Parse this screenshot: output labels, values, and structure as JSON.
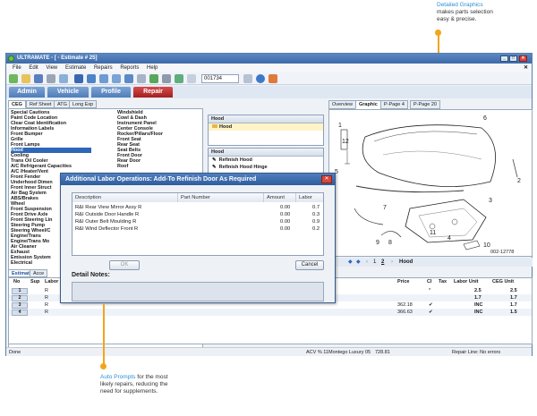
{
  "callouts": {
    "graphics": {
      "highlight": "Detailed Graphics",
      "rest": [
        "makes parts selection",
        "easy & precise."
      ]
    },
    "prompts": {
      "highlight": "Auto Prompts",
      "rest_first": " for the most",
      "rest": [
        "likely repairs, reducing the",
        "need for supplements."
      ]
    }
  },
  "window": {
    "title": "ULTRAMATE - [ - Estimate # 25]",
    "estimate_number": "001734"
  },
  "menu": [
    "File",
    "Edit",
    "View",
    "Estimate",
    "Repairs",
    "Reports",
    "Help"
  ],
  "nav_tabs": [
    {
      "label": "Admin",
      "active": false
    },
    {
      "label": "Vehicle",
      "active": false
    },
    {
      "label": "Profile",
      "active": false
    },
    {
      "label": "Repair",
      "active": true
    }
  ],
  "sub_tabs": [
    {
      "label": "CEG",
      "active": true
    },
    {
      "label": "Ref Sheet",
      "active": false
    },
    {
      "label": "ATG",
      "active": false
    },
    {
      "label": "Long Exp",
      "active": false
    }
  ],
  "categories_col1": [
    "Special Cautions",
    "Paint Code Location",
    "Clear Coat Identification",
    "Information Labels",
    "Front Bumper",
    "Grille",
    "Front Lamps",
    "Hood",
    "Cooling",
    "Trans Oil Cooler",
    "A/C Refrigerant Capacities",
    "A/C /Heater/Vent",
    "Front Fender",
    "Underhood Dimen",
    "Front Inner Struct",
    "Air Bag System",
    "ABS/Brakes",
    "Wheel",
    "Front Suspension",
    "Front Drive Axle",
    "Front Steering Lin",
    "Steering Pump",
    "Steering Wheel/C",
    "Engine/Trans",
    "Engine/Trans Mo",
    "Air Cleaner",
    "Exhaust",
    "Emission System",
    "Electrical"
  ],
  "selected_category": "Hood",
  "categories_col2": [
    "Windshield",
    "Cowl & Dash",
    "Instrument Panel",
    "Center Console",
    "Rocker/Pillars/Floor",
    "Front Seat",
    "Rear Seat",
    "Seat Belts",
    "Front Door",
    "Rear Door",
    "Roof"
  ],
  "mid_panel": {
    "header1": "Hood",
    "item1": "Hood",
    "header2": "Hood",
    "items2": [
      "Refinish Hood",
      "Refinish Hood Hinge"
    ]
  },
  "graphic_tabs": [
    {
      "label": "Overview",
      "active": false
    },
    {
      "label": "Graphic",
      "active": true
    },
    {
      "label": "P-Page 4",
      "active": false
    },
    {
      "label": "P-Page 20",
      "active": false
    }
  ],
  "graphic": {
    "callout_numbers": [
      "1",
      "6",
      "12",
      "5",
      "2",
      "7",
      "3",
      "11",
      "4",
      "9",
      "8",
      "10"
    ],
    "part_code": "002-12778",
    "pages": [
      "1",
      "2"
    ],
    "section": "Hood"
  },
  "estimate_tabs": [
    {
      "label": "Estimate",
      "active": true
    },
    {
      "label": "Acce",
      "active": false
    }
  ],
  "estimate_headers": {
    "no": "No",
    "sup": "Sup",
    "labor": "Labor",
    "price": "Price",
    "cl": "Cl",
    "tax": "Tax",
    "labor_unit": "Labor Unit",
    "ceg_unit": "CEG Unit"
  },
  "estimate_rows": [
    {
      "no": "1",
      "sup": "R",
      "price": "",
      "cl": "*",
      "tax": "",
      "labor_unit": "2.5",
      "ceg_unit": "2.5"
    },
    {
      "no": "2",
      "sup": "R",
      "price": "",
      "cl": "",
      "tax": "",
      "labor_unit": "1.7",
      "ceg_unit": "1.7"
    },
    {
      "no": "3",
      "sup": "R",
      "price": "362.18",
      "cl": "✔",
      "tax": "",
      "labor_unit": "INC",
      "ceg_unit": "1.7"
    },
    {
      "no": "4",
      "sup": "R",
      "price": "366.63",
      "cl": "✔",
      "tax": "",
      "labor_unit": "INC",
      "ceg_unit": "1.5"
    }
  ],
  "status": {
    "left": "Done",
    "acv": "ACV % 11",
    "vehicle": "Montego Luxury 05",
    "amount": "728.81",
    "right": "Repair Line: No errors"
  },
  "dialog": {
    "title": "Additional Labor Operations: Add-To Refinish Door As Required",
    "headers": {
      "description": "Description",
      "part_number": "Part Number",
      "amount": "Amount",
      "labor": "Labor"
    },
    "rows": [
      {
        "description": "R&I Rear View Mirror Assy  R",
        "amount": "0.00",
        "labor": "0.7"
      },
      {
        "description": "R&I Outside Door Handle  R",
        "amount": "0.00",
        "labor": "0.3"
      },
      {
        "description": "R&I Outer Belt Moulding  R",
        "amount": "0.00",
        "labor": "0.9"
      },
      {
        "description": "R&I Wind Deflector Front  R",
        "amount": "0.00",
        "labor": "0.2"
      }
    ],
    "ok_label": "OK",
    "cancel_label": "Cancel",
    "detail_notes_label": "Detail Notes:"
  }
}
